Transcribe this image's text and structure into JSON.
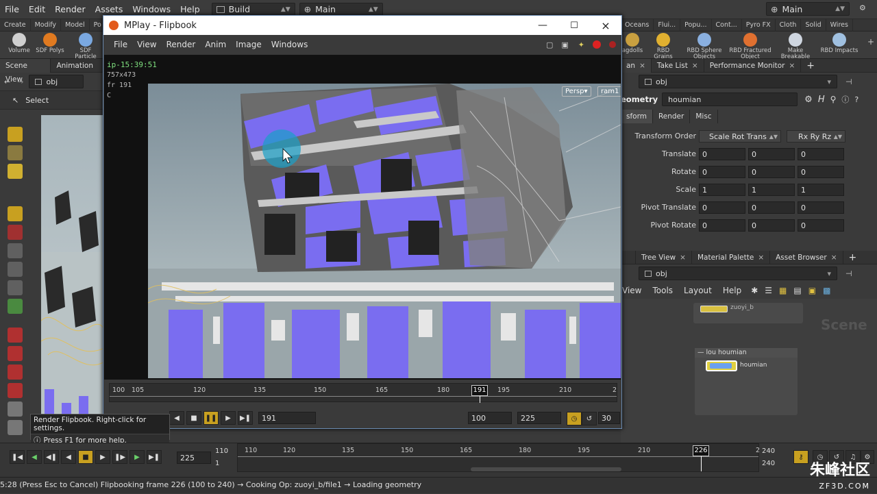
{
  "menubar": {
    "items": [
      "File",
      "Edit",
      "Render",
      "Assets",
      "Windows",
      "Help"
    ],
    "desktop1": "Build",
    "desktop2": "Main",
    "desktop_right": "Main"
  },
  "shelf_tabs_left": [
    "Create",
    "Modify",
    "Model",
    "Po"
  ],
  "shelf_tabs_right": [
    "Oceans",
    "Flui...",
    "Popu...",
    "Cont...",
    "Pyro FX",
    "Cloth",
    "Solid",
    "Wires"
  ],
  "shelf_tools_left": [
    {
      "label": "Volume",
      "color": "#cfcfcf"
    },
    {
      "label": "SDF Polys",
      "color": "#e07a20"
    },
    {
      "label": "SDF Particle",
      "color": "#7aa8e0"
    }
  ],
  "shelf_tools_right": [
    {
      "label": "agdolls",
      "color": "#c9a040"
    },
    {
      "label": "RBD Grains",
      "color": "#e0b030"
    },
    {
      "label": "RBD Sphere Objects",
      "color": "#8ab0e0"
    },
    {
      "label": "RBD Fractured Object",
      "color": "#e07030"
    },
    {
      "label": "Make Breakable",
      "color": "#cfd6e0"
    },
    {
      "label": "RBD Impacts",
      "color": "#a0c0e0"
    }
  ],
  "left_pane": {
    "tabs": [
      "Scene View",
      "Animation E"
    ],
    "path": "obj",
    "select_label": "Select"
  },
  "mplay": {
    "title": "MPlay - Flipbook",
    "menu": [
      "File",
      "View",
      "Render",
      "Anim",
      "Image",
      "Windows"
    ],
    "info_name": "ip-15:39:51",
    "info_res": "757x473",
    "info_frame": "fr 191",
    "info_c": "C",
    "persp": "Persp",
    "cam": "ram1",
    "ruler_ticks": [
      "100",
      "105",
      "120",
      "135",
      "150",
      "165",
      "180",
      "195",
      "210",
      "2"
    ],
    "current_frame_marker": "191",
    "frame_field": "191",
    "range_start": "100",
    "range_end": "225",
    "fps": "30"
  },
  "tooltip": {
    "line1": "Render Flipbook. Right-click for settings.",
    "line2": "Press F1 for more help."
  },
  "right_top": {
    "tabs": [
      "an",
      "Take List",
      "Performance Monitor"
    ],
    "path": "obj",
    "geo_label": "eometry",
    "geo_name": "houmian",
    "param_tabs": [
      "sform",
      "Render",
      "Misc"
    ],
    "transform_order_label": "Transform Order",
    "transform_order": "Scale Rot Trans",
    "rot_order": "Rx Ry Rz",
    "params": [
      {
        "label": "Translate",
        "v": [
          "0",
          "0",
          "0"
        ]
      },
      {
        "label": "Rotate",
        "v": [
          "0",
          "0",
          "0"
        ]
      },
      {
        "label": "Scale",
        "v": [
          "1",
          "1",
          "1"
        ]
      },
      {
        "label": "Pivot Translate",
        "v": [
          "0",
          "0",
          "0"
        ]
      },
      {
        "label": "Pivot Rotate",
        "v": [
          "0",
          "0",
          "0"
        ]
      }
    ]
  },
  "right_bottom": {
    "tabs": [
      "Tree View",
      "Material Palette",
      "Asset Browser"
    ],
    "path": "obj",
    "menu": [
      "View",
      "Tools",
      "Layout",
      "Help"
    ],
    "top_node": "zuoyi_b",
    "network_box": "lou houmian",
    "node": "houmian",
    "watermark": "Scene"
  },
  "main_timeline": {
    "frame_field": "225",
    "start_a": "110",
    "start_b": "1",
    "ticks": [
      "110",
      "120",
      "135",
      "150",
      "165",
      "180",
      "195",
      "210",
      "2"
    ],
    "current_marker": "226",
    "end_a": "240",
    "end_b": "240"
  },
  "status": "5:28 (Press Esc to Cancel) Flipbooking frame 226 (100 to 240) → Cooking Op: zuoyi_b/file1 → Loading geometry",
  "brand": {
    "cn": "朱峰社区",
    "url": "ZF3D.COM"
  }
}
